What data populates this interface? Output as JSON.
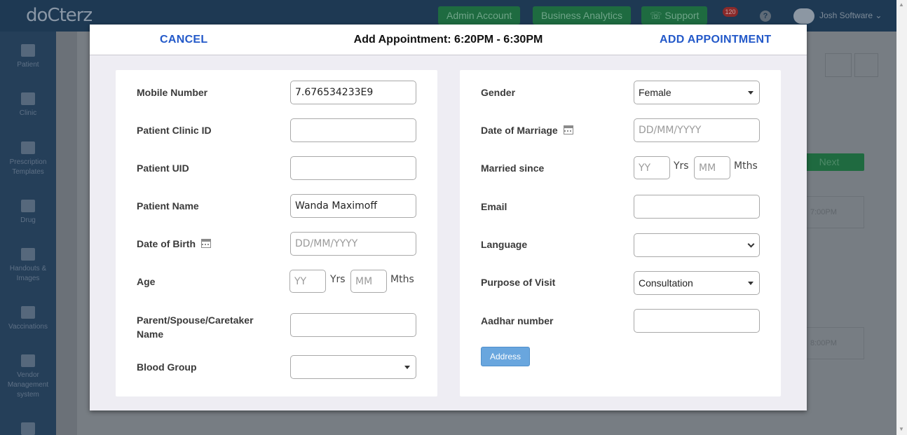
{
  "background": {
    "logo": "doCterz",
    "topbar": {
      "admin_account": "Admin Account",
      "business_analytics": "Business Analytics",
      "support": "Support",
      "notification_count": "120",
      "user_name": "Josh Software"
    },
    "sidebar": [
      {
        "label": "Patient",
        "icon": "grid-icon"
      },
      {
        "label": "Clinic",
        "icon": "stethoscope-icon"
      },
      {
        "label": "Prescription Templates",
        "icon": "document-icon"
      },
      {
        "label": "Drug",
        "icon": "medkit-icon"
      },
      {
        "label": "Handouts & Images",
        "icon": "book-icon"
      },
      {
        "label": "Vaccinations",
        "icon": "file-icon"
      },
      {
        "label": "Vendor Management system",
        "icon": "file-list-icon"
      }
    ],
    "next_button": "Next",
    "slot_times": [
      "7:00PM",
      "8:00PM"
    ]
  },
  "modal": {
    "cancel_label": "CANCEL",
    "title": "Add Appointment: 6:20PM - 6:30PM",
    "add_label": "ADD APPOINTMENT",
    "left": {
      "mobile_number": {
        "label": "Mobile Number",
        "value": "7.676534233E9"
      },
      "patient_clinic_id": {
        "label": "Patient Clinic ID",
        "value": ""
      },
      "patient_uid": {
        "label": "Patient UID",
        "value": ""
      },
      "patient_name": {
        "label": "Patient Name",
        "value": "Wanda Maximoff"
      },
      "date_of_birth": {
        "label": "Date of Birth",
        "placeholder": "DD/MM/YYYY"
      },
      "age": {
        "label": "Age",
        "yy_placeholder": "YY",
        "yrs": "Yrs",
        "mm_placeholder": "MM",
        "mths": "Mths"
      },
      "caretaker": {
        "label": "Parent/Spouse/Caretaker Name",
        "value": ""
      },
      "blood_group": {
        "label": "Blood Group",
        "value": ""
      }
    },
    "right": {
      "gender": {
        "label": "Gender",
        "value": "Female"
      },
      "date_of_marriage": {
        "label": "Date of Marriage",
        "placeholder": "DD/MM/YYYY"
      },
      "married_since": {
        "label": "Married since",
        "yy_placeholder": "YY",
        "yrs": "Yrs",
        "mm_placeholder": "MM",
        "mths": "Mths"
      },
      "email": {
        "label": "Email",
        "value": ""
      },
      "language": {
        "label": "Language",
        "value": ""
      },
      "purpose_of_visit": {
        "label": "Purpose of Visit",
        "value": "Consultation"
      },
      "aadhar_number": {
        "label": "Aadhar number",
        "value": ""
      },
      "address_button": "Address"
    }
  },
  "colors": {
    "link_blue": "#2359c9",
    "address_button": "#69a6de",
    "modal_bg": "#eeedf3"
  }
}
